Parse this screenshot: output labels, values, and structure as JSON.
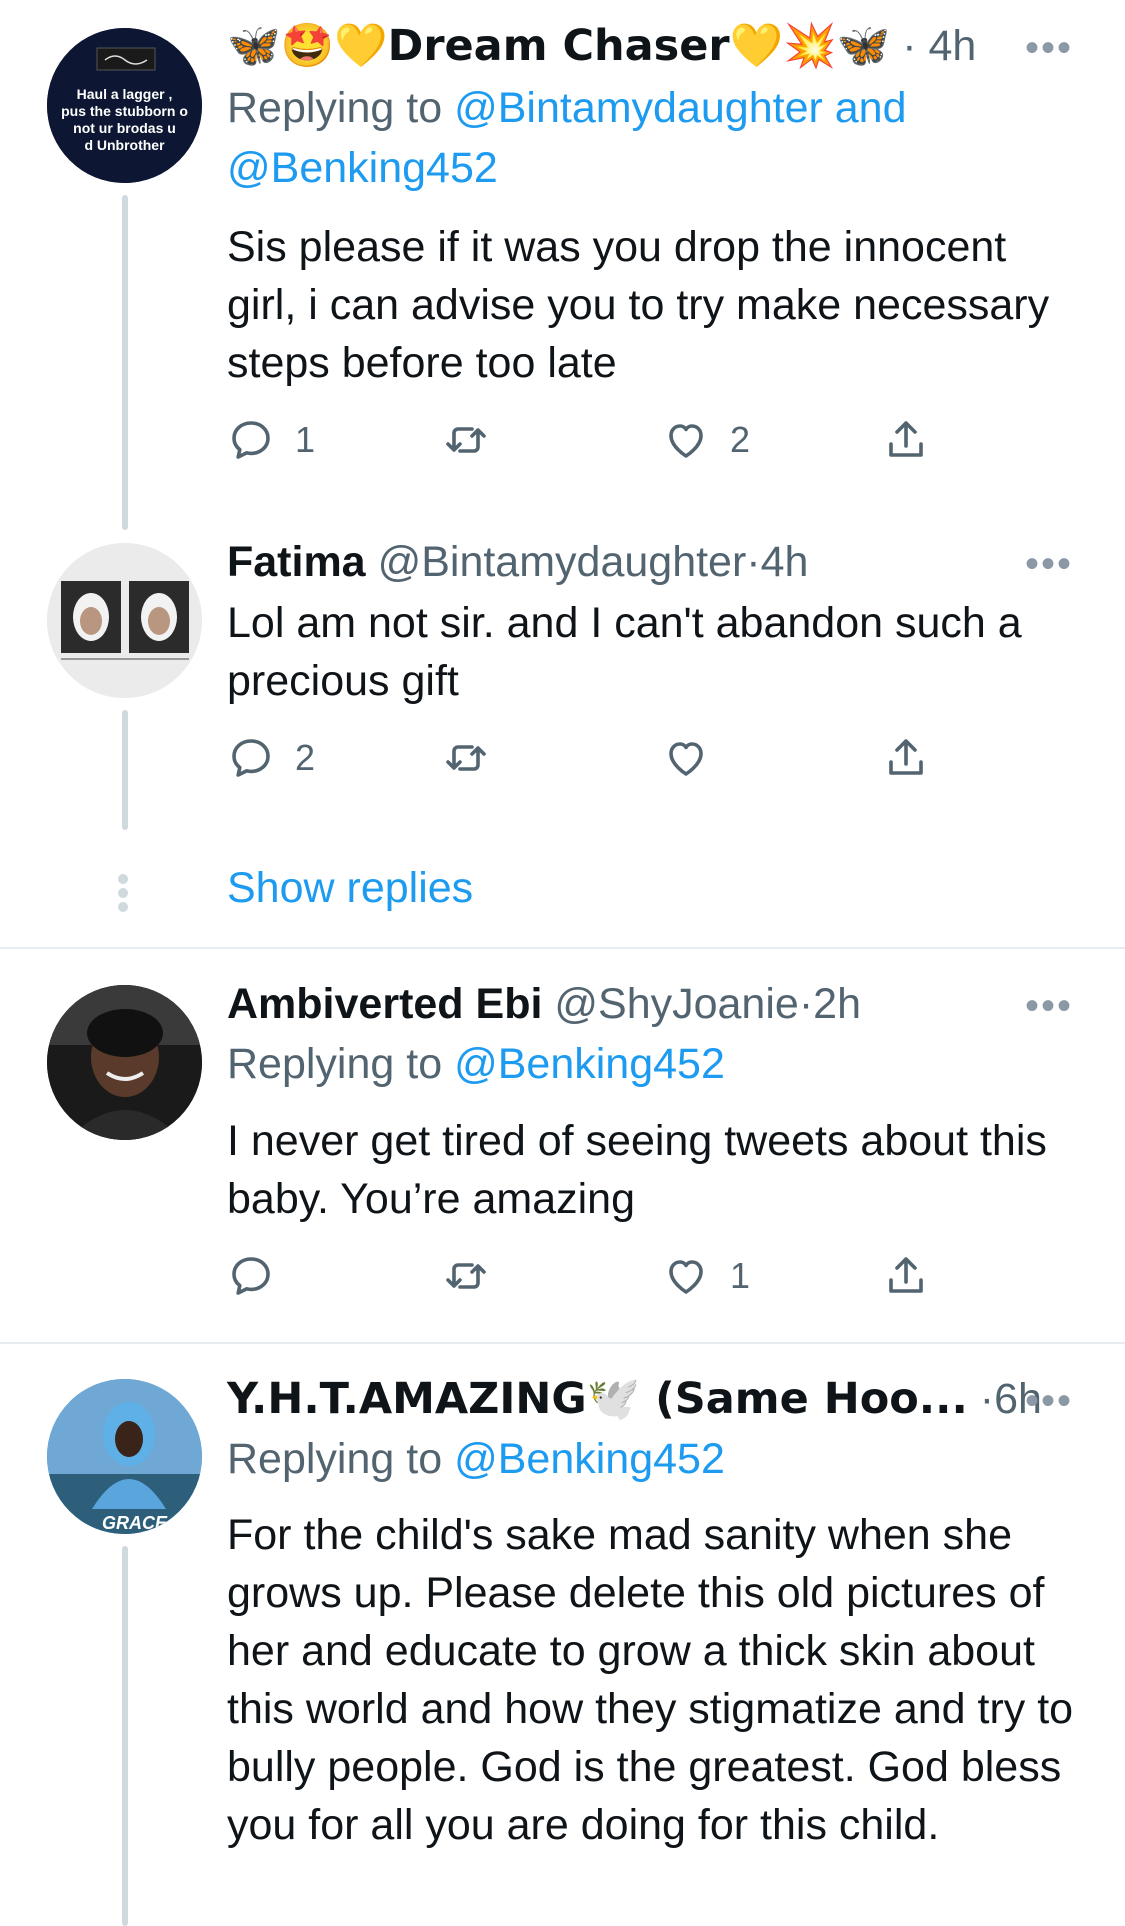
{
  "tweets": [
    {
      "name": "🦋🤩💛Dream Chaser💛💥🦋",
      "handle": "",
      "time": "4h",
      "reply_prefix": "Replying to ",
      "reply_mentions": "@Bintamydaughter and",
      "reply_mentions_2": "@Benking452",
      "body": "Sis please if it was you drop the innocent girl, i can advise you to try make necessary steps before too late",
      "reply_count": "1",
      "retweet_count": "",
      "like_count": "2",
      "avatar_text": "Haul a lagger, pus the stubborn o not ur brodas u d Unbrother"
    },
    {
      "name": "Fatima",
      "handle": "@Bintamydaughter",
      "time": "4h",
      "body": "Lol am not sir. and I can't abandon such a precious gift",
      "reply_count": "2",
      "retweet_count": "",
      "like_count": ""
    },
    {
      "name": "Ambiverted Ebi",
      "handle": "@ShyJoanie",
      "time": "2h",
      "reply_prefix": "Replying to ",
      "reply_mentions": "@Benking452",
      "body": "I never get tired of seeing tweets about this baby. You’re amazing",
      "reply_count": "",
      "retweet_count": "",
      "like_count": "1"
    },
    {
      "name": "Y.H.T.AMAZING🕊️ (Same Hoo...",
      "handle": "",
      "time": "6h",
      "reply_prefix": "Replying to ",
      "reply_mentions": "@Benking452",
      "body": "For the child's sake mad sanity when she grows up. Please delete this old pictures of her and educate to grow a thick skin about this world and how they stigmatize and try to bully people. God is the greatest. God bless you for all you are doing for this child.",
      "avatar_text": "GRACE"
    }
  ],
  "show_replies_label": "Show replies",
  "separator_dot": "·",
  "more_glyph": "•••",
  "colors": {
    "link": "#1d9bf0",
    "muted": "#536471",
    "line": "#cfd9de"
  }
}
